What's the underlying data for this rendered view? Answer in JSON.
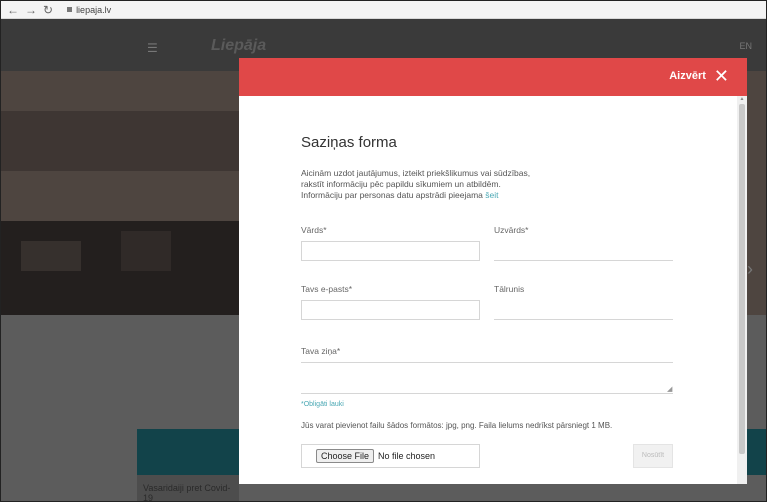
{
  "browser": {
    "back_icon": "arrow-left-icon",
    "forward_icon": "arrow-right-icon",
    "reload_icon": "reload-icon",
    "url": "liepaja.lv"
  },
  "background": {
    "logo": "Liepāja",
    "lang": "EN",
    "card_text": "Vasaridaiji pret Covid-19"
  },
  "modal": {
    "close_label": "Aizvērt",
    "close_icon": "close-icon",
    "title": "Saziņas forma",
    "intro_text": "Aicinām uzdot jautājumus, izteikt priekšlikumus vai sūdzības, ",
    "intro_text_2": "rakstīt informāciju pēc papildu sīkumiem un atbildēm.",
    "intro_text_3": "Informāciju par personas datu apstrādi pieejama ",
    "intro_link": "šeit",
    "fields": {
      "first_name_label": "Vārds*",
      "last_name_label": "Uzvārds*",
      "email_label": "Tavs e-pasts*",
      "phone_label": "Tālrunis",
      "message_label": "Tava ziņa*"
    },
    "required_note": "*Obligāti lauki",
    "attach_note": "Jūs varat pievienot failu šādos formātos: jpg, png. Faila lielums nedrīkst pārsniegt 1 MB.",
    "choose_file_label": "Choose File",
    "no_file_label": "No file chosen",
    "send_label": "Nosūtīt"
  },
  "colors": {
    "modal_header": "#e04848",
    "link": "#4aa8b4",
    "overlay": "#3a3a3a"
  }
}
